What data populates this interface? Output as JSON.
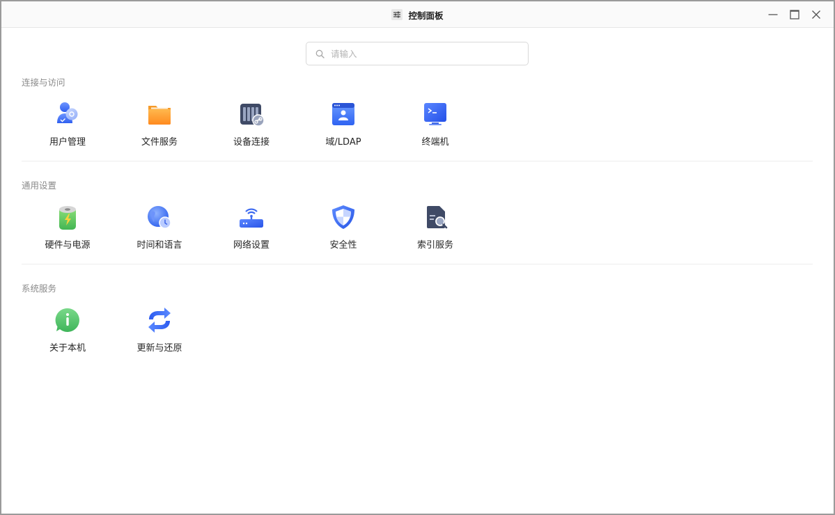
{
  "window": {
    "title": "控制面板",
    "title_icon": "sliders-icon",
    "controls": {
      "minimize": "minimize-icon",
      "maximize": "maximize-icon",
      "close": "close-icon"
    }
  },
  "search": {
    "placeholder": "请输入",
    "value": ""
  },
  "sections": [
    {
      "title": "连接与访问",
      "items": [
        {
          "label": "用户管理",
          "icon": "users-icon"
        },
        {
          "label": "文件服务",
          "icon": "folder-icon"
        },
        {
          "label": "设备连接",
          "icon": "device-link-icon"
        },
        {
          "label": "域/LDAP",
          "icon": "domain-ldap-icon"
        },
        {
          "label": "终端机",
          "icon": "terminal-icon"
        }
      ]
    },
    {
      "title": "通用设置",
      "items": [
        {
          "label": "硬件与电源",
          "icon": "battery-icon"
        },
        {
          "label": "时间和语言",
          "icon": "globe-clock-icon"
        },
        {
          "label": "网络设置",
          "icon": "router-icon"
        },
        {
          "label": "安全性",
          "icon": "shield-icon"
        },
        {
          "label": "索引服务",
          "icon": "index-search-icon"
        }
      ]
    },
    {
      "title": "系统服务",
      "items": [
        {
          "label": "关于本机",
          "icon": "info-icon"
        },
        {
          "label": "更新与还原",
          "icon": "update-restore-icon"
        }
      ]
    }
  ],
  "colors": {
    "accent": "#3d6ff5",
    "border": "#9a9a9a",
    "divider": "#ececec"
  }
}
